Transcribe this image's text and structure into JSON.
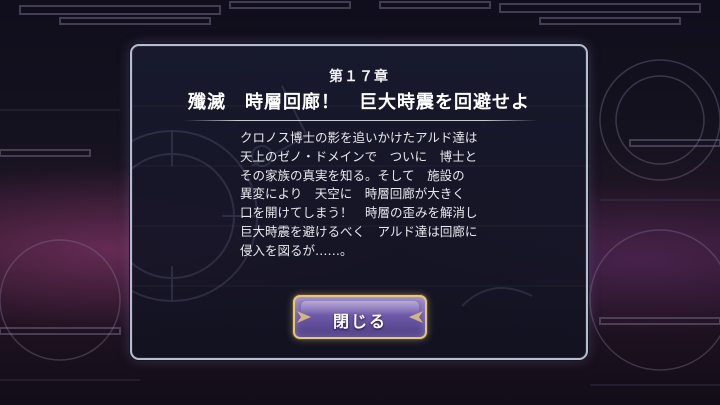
{
  "dialog": {
    "chapter_label": "第１７章",
    "chapter_title": "殲滅　時層回廊！　巨大時震を回避せよ",
    "story_lines": [
      "クロノス博士の影を追いかけたアルド達は",
      "天上のゼノ・ドメインで　ついに　博士と",
      "その家族の真実を知る。そして　施設の",
      "異変により　天空に　時層回廊が大きく",
      "口を開けてしまう！　時層の歪みを解消し",
      "巨大時震を避けるべく　アルド達は回廊に",
      "侵入を図るが……。"
    ],
    "close_button_label": "閉じる"
  },
  "icons": {
    "dialog_emblem": "clock-emblem-icon",
    "button_ornaments": "wing-ornament-icon"
  },
  "colors": {
    "dialog_border": "#b7bdd0",
    "dialog_background": "#181a2e",
    "button_fill": "#6f5aa8",
    "button_border": "#e2c77e",
    "text": "#ffffff"
  }
}
